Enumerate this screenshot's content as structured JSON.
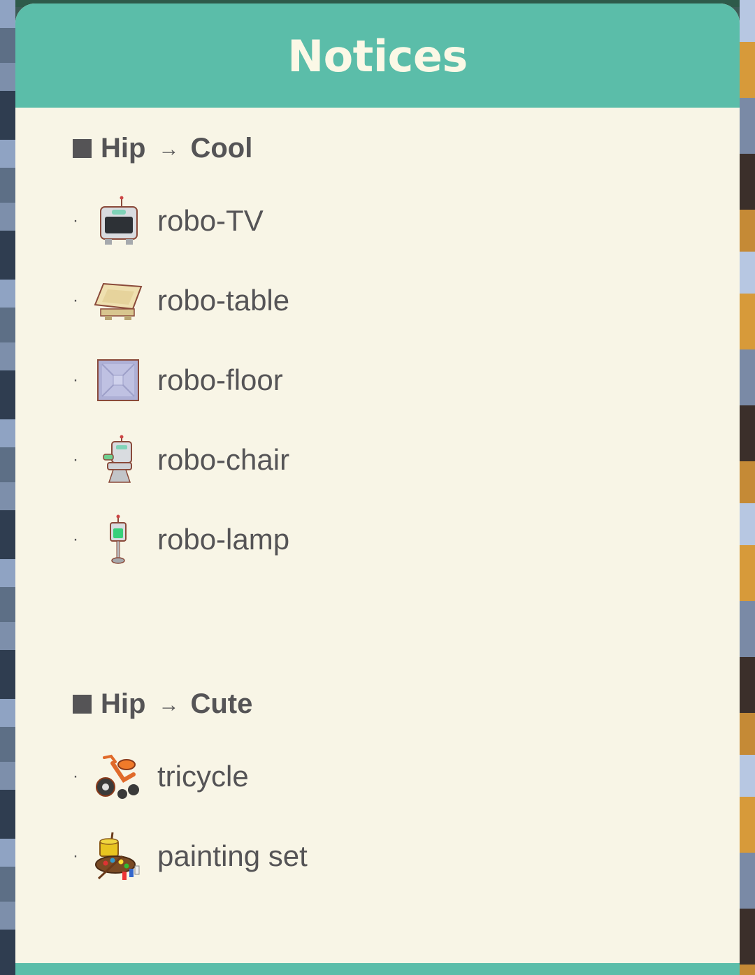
{
  "dialog": {
    "title": "Notices"
  },
  "sections": [
    {
      "from": "Hip",
      "arrow": "→",
      "to": "Cool",
      "items": [
        {
          "bullet": "·",
          "icon": "robo-tv-icon",
          "label": "robo-TV"
        },
        {
          "bullet": "·",
          "icon": "robo-table-icon",
          "label": "robo-table"
        },
        {
          "bullet": "·",
          "icon": "robo-floor-icon",
          "label": "robo-floor"
        },
        {
          "bullet": "·",
          "icon": "robo-chair-icon",
          "label": "robo-chair"
        },
        {
          "bullet": "·",
          "icon": "robo-lamp-icon",
          "label": "robo-lamp"
        }
      ]
    },
    {
      "from": "Hip",
      "arrow": "→",
      "to": "Cute",
      "items": [
        {
          "bullet": "·",
          "icon": "tricycle-icon",
          "label": "tricycle"
        },
        {
          "bullet": "·",
          "icon": "painting-set-icon",
          "label": "painting set"
        }
      ]
    }
  ],
  "colors": {
    "header": "#5bbda9",
    "panel": "#f8f5e6",
    "title_text": "#fbf8e6",
    "body_text": "#555456"
  }
}
